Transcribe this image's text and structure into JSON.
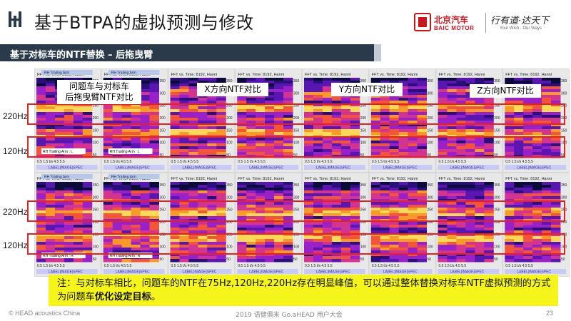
{
  "header": {
    "title": "基于BTPA的虚拟预测与修改",
    "brand_cn": "北京汽车",
    "brand_en": "BAIC MOTOR",
    "slogan": "行有道·达天下",
    "slogan_en": "Your Wish · Our Ways"
  },
  "section": {
    "title": "基于对标车的NTF替换 – 后拖曳臂"
  },
  "callouts": {
    "c1": "问题车与对标车\n后拖曳臂NTF对比",
    "c2": "X方向NTF对比",
    "c3": "Y方向NTF对比",
    "c4": "Z方向NTF对比"
  },
  "freq_labels": {
    "top_220": "220Hz",
    "top_120": "120Hz",
    "bot_220": "220Hz",
    "bot_120": "120Hz"
  },
  "panel_text": {
    "tab": "RH Trailing Arm",
    "header": "FFT vs. Time: 8192, Hanni",
    "trace_left": "RH Trailing Arm : L",
    "trace_right": "RH Trailing Arm : R",
    "tick_x": "0.5  1.5    t/s    4.5  5.5",
    "y_ticks_top": [
      "350",
      "300",
      "250",
      "200",
      "150",
      "100",
      "50"
    ],
    "footer": "LABEL|IMAGE|SPEC"
  },
  "note": {
    "prefix": "注：与对标车相比，问题车的NTF在75Hz,120Hz,220Hz存在明显峰值，可以通过整体替换对标车NTF虚拟预测的方式为问题车",
    "bold": "优化设定目标",
    "suffix": "。"
  },
  "footer": {
    "left": "© HEAD acoustics China",
    "center": "2019 语健俱来 Go.aHEAD 用户大会",
    "page": "23"
  },
  "colors": {
    "accent_red": "#e32222",
    "section_bg": "#2b3a4a",
    "note_bg": "#f5f51c"
  }
}
